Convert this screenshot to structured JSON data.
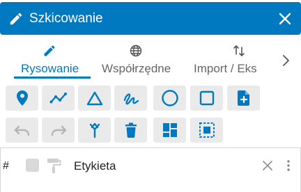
{
  "header": {
    "title": "Szkicowanie",
    "background": "#0079c1",
    "icon": "pencil-icon",
    "close_icon": "close-icon"
  },
  "tabs": [
    {
      "label": "Rysowanie",
      "icon": "pencil-icon",
      "active": true
    },
    {
      "label": "Współrzędne",
      "icon": "globe-icon",
      "active": false
    },
    {
      "label": "Import / Eks",
      "icon": "sort-arrows-icon",
      "active": false
    }
  ],
  "tabs_next_icon": "chevron-right-icon",
  "colors": {
    "accent": "#0079c1",
    "button_bg": "#eaeaea",
    "icon_disabled": "#b4b4b4"
  },
  "toolbar_row1": [
    {
      "icon": "location-pin-icon"
    },
    {
      "icon": "polyline-icon"
    },
    {
      "icon": "triangle-icon"
    },
    {
      "icon": "freehand-icon"
    },
    {
      "icon": "circle-icon"
    },
    {
      "icon": "rectangle-icon"
    },
    {
      "icon": "add-file-icon"
    }
  ],
  "toolbar_row2": [
    {
      "icon": "undo-icon",
      "enabled": false
    },
    {
      "icon": "redo-icon",
      "enabled": false
    },
    {
      "icon": "merge-icon",
      "enabled": true
    },
    {
      "icon": "trash-icon",
      "enabled": true
    },
    {
      "icon": "dashboard-layout-icon",
      "enabled": true
    },
    {
      "icon": "select-area-icon",
      "enabled": true
    }
  ],
  "table": {
    "hash_label": "#",
    "row_label": "Etykieta"
  }
}
